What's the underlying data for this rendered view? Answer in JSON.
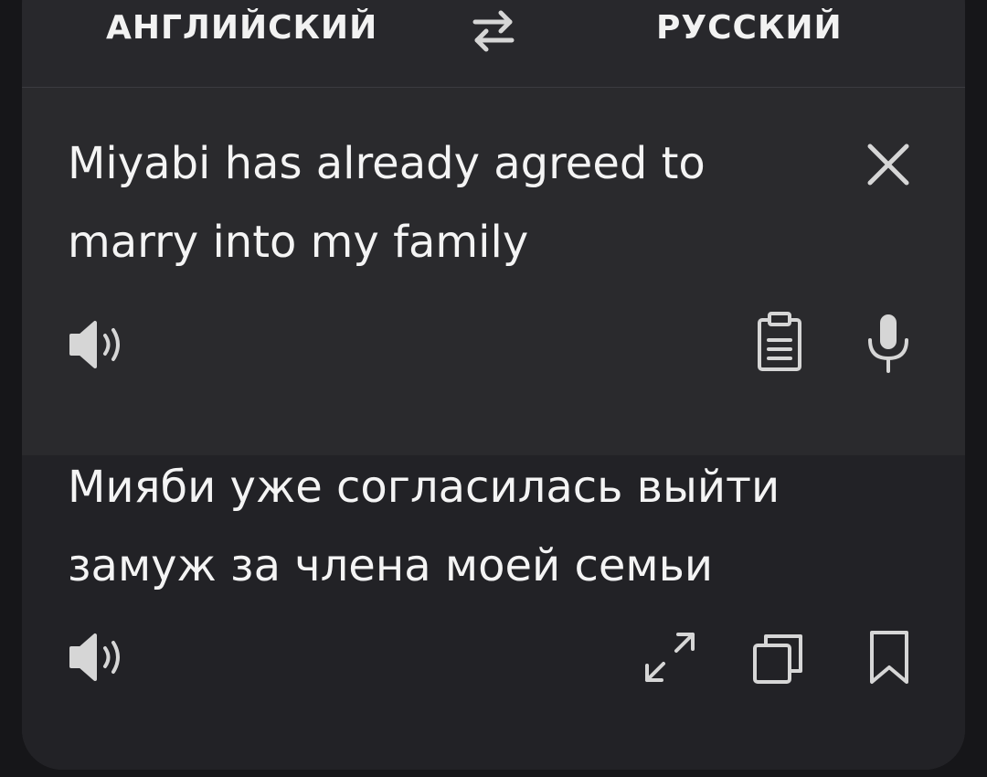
{
  "languages": {
    "source": "АНГЛИЙСКИЙ",
    "target": "РУССКИЙ",
    "swap_icon": "swap-arrows-icon"
  },
  "source": {
    "text": "Miyabi has already agreed to marry into my family",
    "icons": [
      "close-icon",
      "speaker-icon",
      "clipboard-icon",
      "microphone-icon"
    ]
  },
  "result": {
    "text": "Мияби уже согласилась выйти замуж за члена моей семьи",
    "icons": [
      "speaker-icon",
      "expand-icon",
      "copy-icon",
      "bookmark-icon"
    ]
  },
  "colors": {
    "background": "#161619",
    "card": "#28282c",
    "result_panel": "#222226",
    "text": "#f4f4f4",
    "icon": "#d6d6d6"
  }
}
